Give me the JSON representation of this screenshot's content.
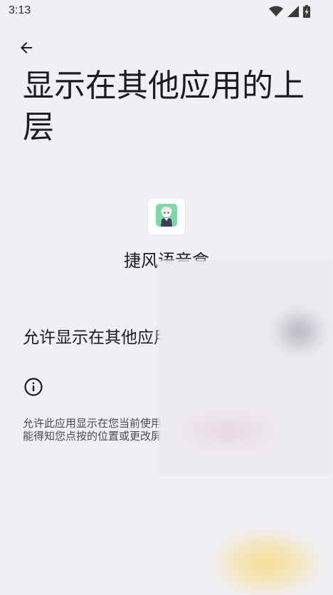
{
  "status_bar": {
    "time": "3:13",
    "icons": [
      "wifi-icon",
      "cellular-signal-icon",
      "battery-charging-icon"
    ]
  },
  "header": {
    "back_icon": "arrow-back-icon",
    "title": "显示在其他应用的上层"
  },
  "app": {
    "name": "捷风语音盒",
    "icon": "app-avatar-icon",
    "icon_bg": "#7fd6a8"
  },
  "permission": {
    "label": "允许显示在其他应用的上层",
    "enabled": false
  },
  "info": {
    "icon": "info-icon",
    "description": "允许此应用显示在您当前使用的其他应用的上层。此应用将能得知您点按的位置或更改屏幕上显示的内容。"
  },
  "colors": {
    "background": "#f1eff4",
    "text": "#1c1b1f",
    "secondary_text": "#4a4750",
    "switch_outline": "#78757f"
  }
}
